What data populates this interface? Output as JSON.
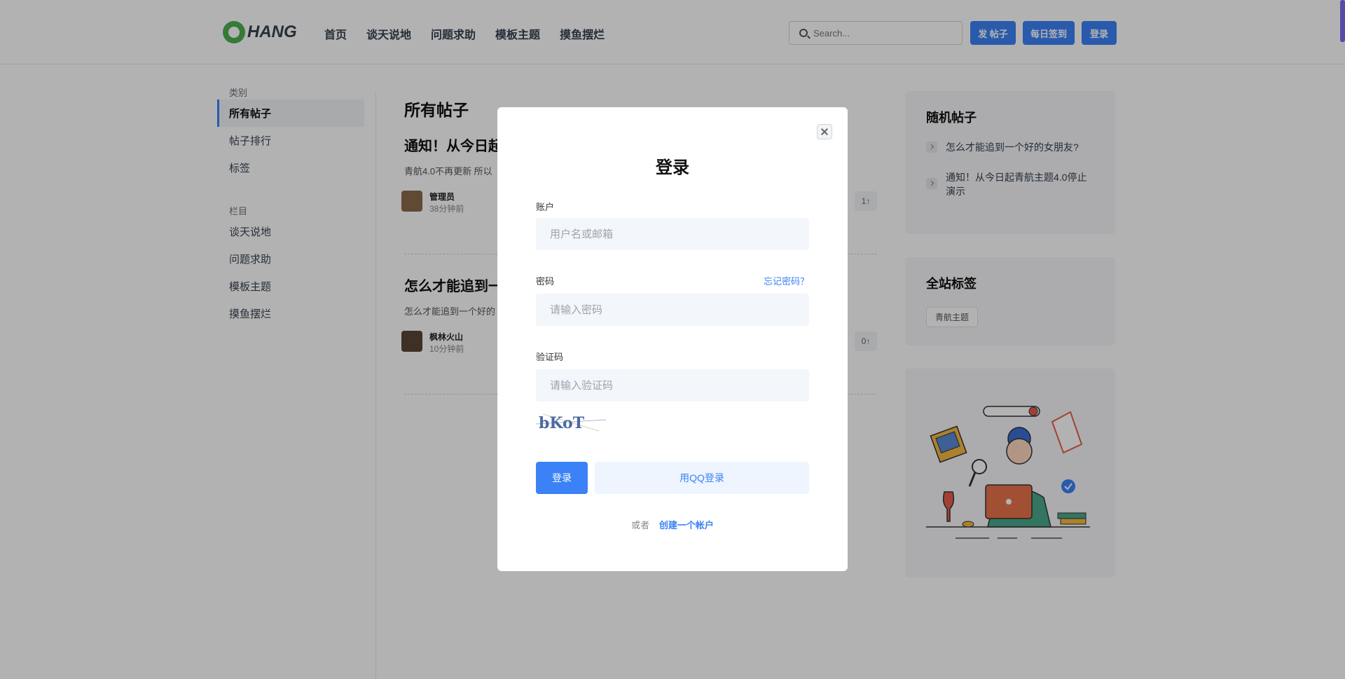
{
  "header": {
    "logo_text": "HANG",
    "nav": [
      "首页",
      "谈天说地",
      "问题求助",
      "模板主题",
      "摸鱼摆烂"
    ],
    "search_placeholder": "Search...",
    "post_button": "发 帖子",
    "checkin_button": "每日签到",
    "login_button": "登录"
  },
  "sidebar": {
    "category_title": "类别",
    "categories": [
      "所有帖子",
      "帖子排行",
      "标签"
    ],
    "column_title": "栏目",
    "columns": [
      "谈天说地",
      "问题求助",
      "模板主题",
      "摸鱼摆烂"
    ]
  },
  "main": {
    "title": "所有帖子",
    "posts": [
      {
        "title": "通知！从今日起",
        "excerpt": "青航4.0不再更新 所以",
        "author": "管理员",
        "time": "38分钟前",
        "votes": "1"
      },
      {
        "title": "怎么才能追到一",
        "excerpt": "怎么才能追到一个好的",
        "author": "枫林火山",
        "time": "10分钟前",
        "votes": "0"
      }
    ]
  },
  "right": {
    "random_title": "随机帖子",
    "random_posts": [
      "怎么才能追到一个好的女朋友?",
      "通知！从今日起青航主题4.0停止演示"
    ],
    "tags_title": "全站标签",
    "tags": [
      "青航主题"
    ]
  },
  "modal": {
    "title": "登录",
    "account_label": "账户",
    "account_placeholder": "用户名或邮箱",
    "password_label": "密码",
    "forgot_link": "忘记密码？",
    "password_placeholder": "请输入密码",
    "captcha_label": "验证码",
    "captcha_placeholder": "请输入验证码",
    "captcha_text": "bKoT",
    "login_button": "登录",
    "qq_button": "用QQ登录",
    "or_text": "或者",
    "create_link": "创建一个帐户"
  },
  "colors": {
    "accent": "#3b82f6",
    "logo_green": "#4caf50"
  }
}
